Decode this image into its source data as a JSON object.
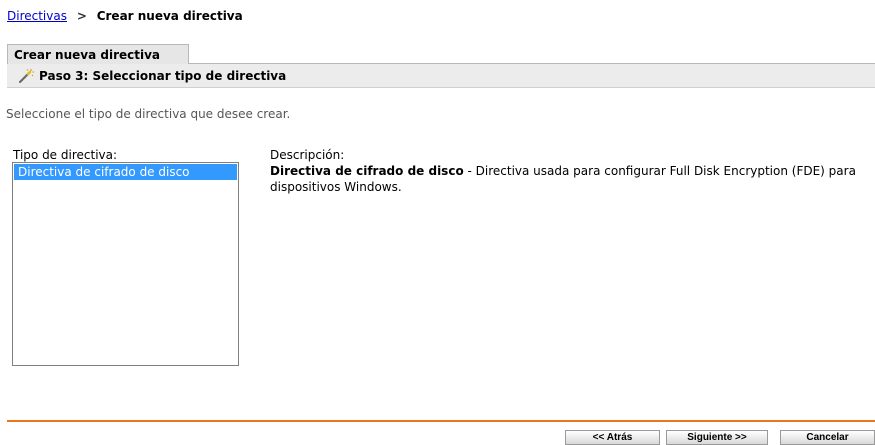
{
  "breadcrumb": {
    "link": "Directivas",
    "separator": ">",
    "current": "Crear nueva directiva"
  },
  "tab": {
    "label": "Crear nueva directiva"
  },
  "step": {
    "icon": "wand-icon",
    "title": "Paso 3: Seleccionar tipo de directiva"
  },
  "instruction": "Seleccione el tipo de directiva que desee crear.",
  "policy_type": {
    "label": "Tipo de directiva:",
    "items": [
      "Directiva de cifrado de disco"
    ],
    "selected_index": 0
  },
  "description": {
    "label": "Descripción:",
    "name": "Directiva de cifrado de disco",
    "text": " - Directiva usada para configurar Full Disk Encryption (FDE) para dispositivos Windows."
  },
  "buttons": {
    "back": "<< Atrás",
    "next": "Siguiente >>",
    "cancel": "Cancelar"
  },
  "colors": {
    "link": "#0000cc",
    "selection": "#3399ff",
    "footer_rule": "#e87722"
  }
}
